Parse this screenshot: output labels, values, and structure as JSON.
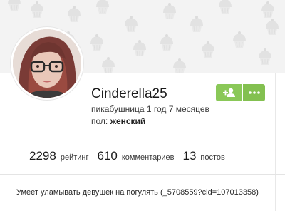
{
  "profile": {
    "username": "Cinderella25",
    "subtitle": "пикабушница 1 год 7 месяцев",
    "gender_label": "пол:",
    "gender_value": "женский"
  },
  "actions": {
    "add_icon": "add-user-icon",
    "more_icon": "more-dots-icon"
  },
  "stats": [
    {
      "value": "2298",
      "label": "рейтинг"
    },
    {
      "value": "610",
      "label": "комментариев"
    },
    {
      "value": "13",
      "label": "постов"
    }
  ],
  "about": "Умеет уламывать девушек на погулять (_5708559?cid=107013358)",
  "colors": {
    "button_green": "#8ac858",
    "header_bg": "#f3f3f3"
  }
}
